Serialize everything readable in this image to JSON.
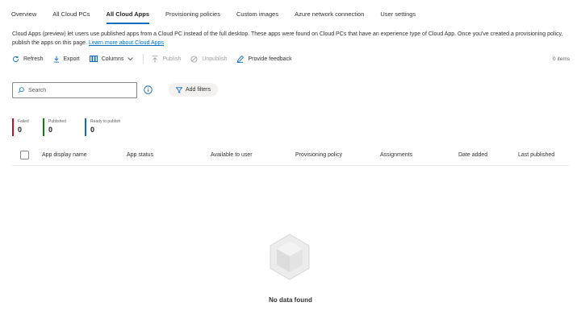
{
  "tabs": [
    {
      "label": "Overview",
      "active": false
    },
    {
      "label": "All Cloud PCs",
      "active": false
    },
    {
      "label": "All Cloud Apps",
      "active": true
    },
    {
      "label": "Provisioning policies",
      "active": false
    },
    {
      "label": "Custom images",
      "active": false
    },
    {
      "label": "Azure network connection",
      "active": false
    },
    {
      "label": "User settings",
      "active": false
    }
  ],
  "description": {
    "text": "Cloud Apps (preview) let users use published apps from a Cloud PC instead of the full desktop. These apps were found on Cloud PCs that have an experience type of Cloud App. Once you've created a provisioning policy, publish the apps on this page.",
    "link": "Learn more about Cloud Apps"
  },
  "toolbar": {
    "refresh": "Refresh",
    "export": "Export",
    "columns": "Columns",
    "publish": "Publish",
    "unpublish": "Unpublish",
    "feedback": "Provide feedback",
    "count": "0 items"
  },
  "search": {
    "placeholder": "Search"
  },
  "filters": {
    "add_label": "Add filters"
  },
  "stats": [
    {
      "label": "Failed",
      "value": "0",
      "color": "#c50f1f"
    },
    {
      "label": "Published",
      "value": "0",
      "color": "#107c10"
    },
    {
      "label": "Ready to publish",
      "value": "0",
      "color": "#0f6cbd"
    }
  ],
  "table": {
    "columns": [
      "App display name",
      "App status",
      "Available to user",
      "Provisioning policy",
      "Assignments",
      "Date added",
      "Last published"
    ]
  },
  "empty": {
    "text": "No data found"
  },
  "colors": {
    "accent": "#0f6cbd",
    "text": "#323130",
    "border": "#8a8886"
  }
}
